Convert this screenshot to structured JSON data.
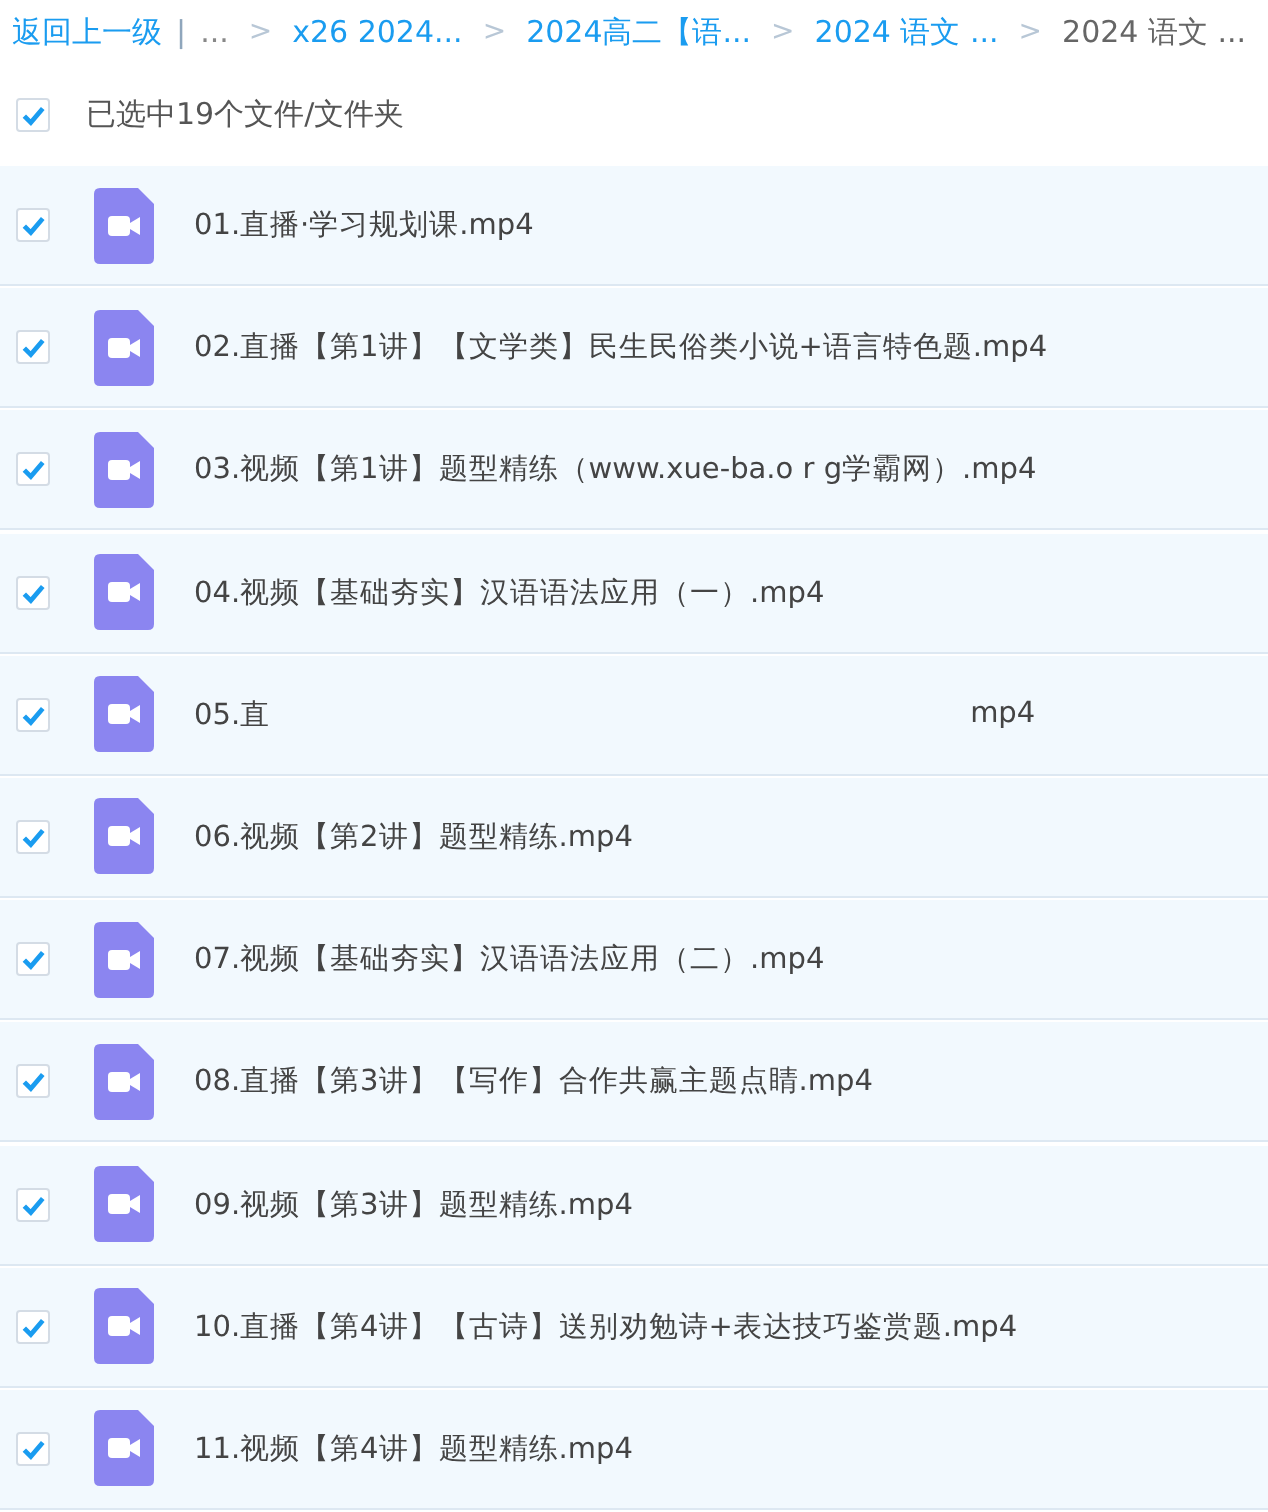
{
  "breadcrumb": {
    "back": "返回上一级",
    "divider": "|",
    "ellipsis": "...",
    "separator": ">",
    "links": [
      "x26 2024...",
      "2024高二【语...",
      "2024 语文 ..."
    ],
    "current": "2024 语文 ..."
  },
  "header": {
    "checked": true,
    "label": "已选中19个文件/文件夹"
  },
  "files": [
    {
      "name": "01.直播·学习规划课.mp4",
      "checked": true
    },
    {
      "name": "02.直播【第1讲】【文学类】民生民俗类小说+语言特色题.mp4",
      "checked": true
    },
    {
      "name": "03.视频【第1讲】题型精练（www.xue-ba.o r g学霸网）.mp4",
      "checked": true
    },
    {
      "name": "04.视频【基础夯实】汉语语法应用（一）.mp4",
      "checked": true
    },
    {
      "name": "05.直",
      "name_end": "mp4",
      "checked": true
    },
    {
      "name": "06.视频【第2讲】题型精练.mp4",
      "checked": true
    },
    {
      "name": "07.视频【基础夯实】汉语语法应用（二）.mp4",
      "checked": true
    },
    {
      "name": "08.直播【第3讲】【写作】合作共赢主题点睛.mp4",
      "checked": true
    },
    {
      "name": "09.视频【第3讲】题型精练.mp4",
      "checked": true
    },
    {
      "name": "10.直播【第4讲】【古诗】送别劝勉诗+表达技巧鉴赏题.mp4",
      "checked": true
    },
    {
      "name": "11.视频【第4讲】题型精练.mp4",
      "checked": true
    }
  ]
}
